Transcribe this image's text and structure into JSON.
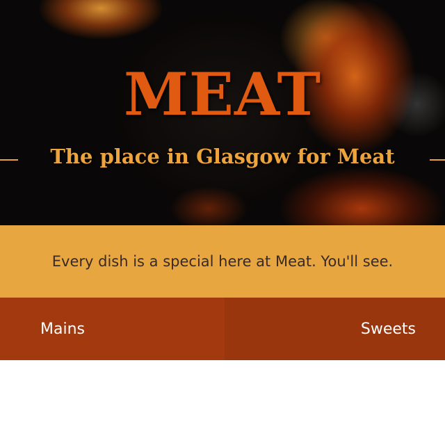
{
  "hero": {
    "title": "MEAT",
    "subtitle": "The place in Glasgow for Meat"
  },
  "tagline": "Every dish is a special here at Meat. You'll see.",
  "nav": {
    "items": [
      {
        "label": "Mains"
      },
      {
        "label": "Sweets"
      }
    ]
  },
  "colors": {
    "title": "#e15a12",
    "subtitle": "#eda43c",
    "tagline_band": "#e8a640",
    "nav_background": "#a33a0f"
  }
}
